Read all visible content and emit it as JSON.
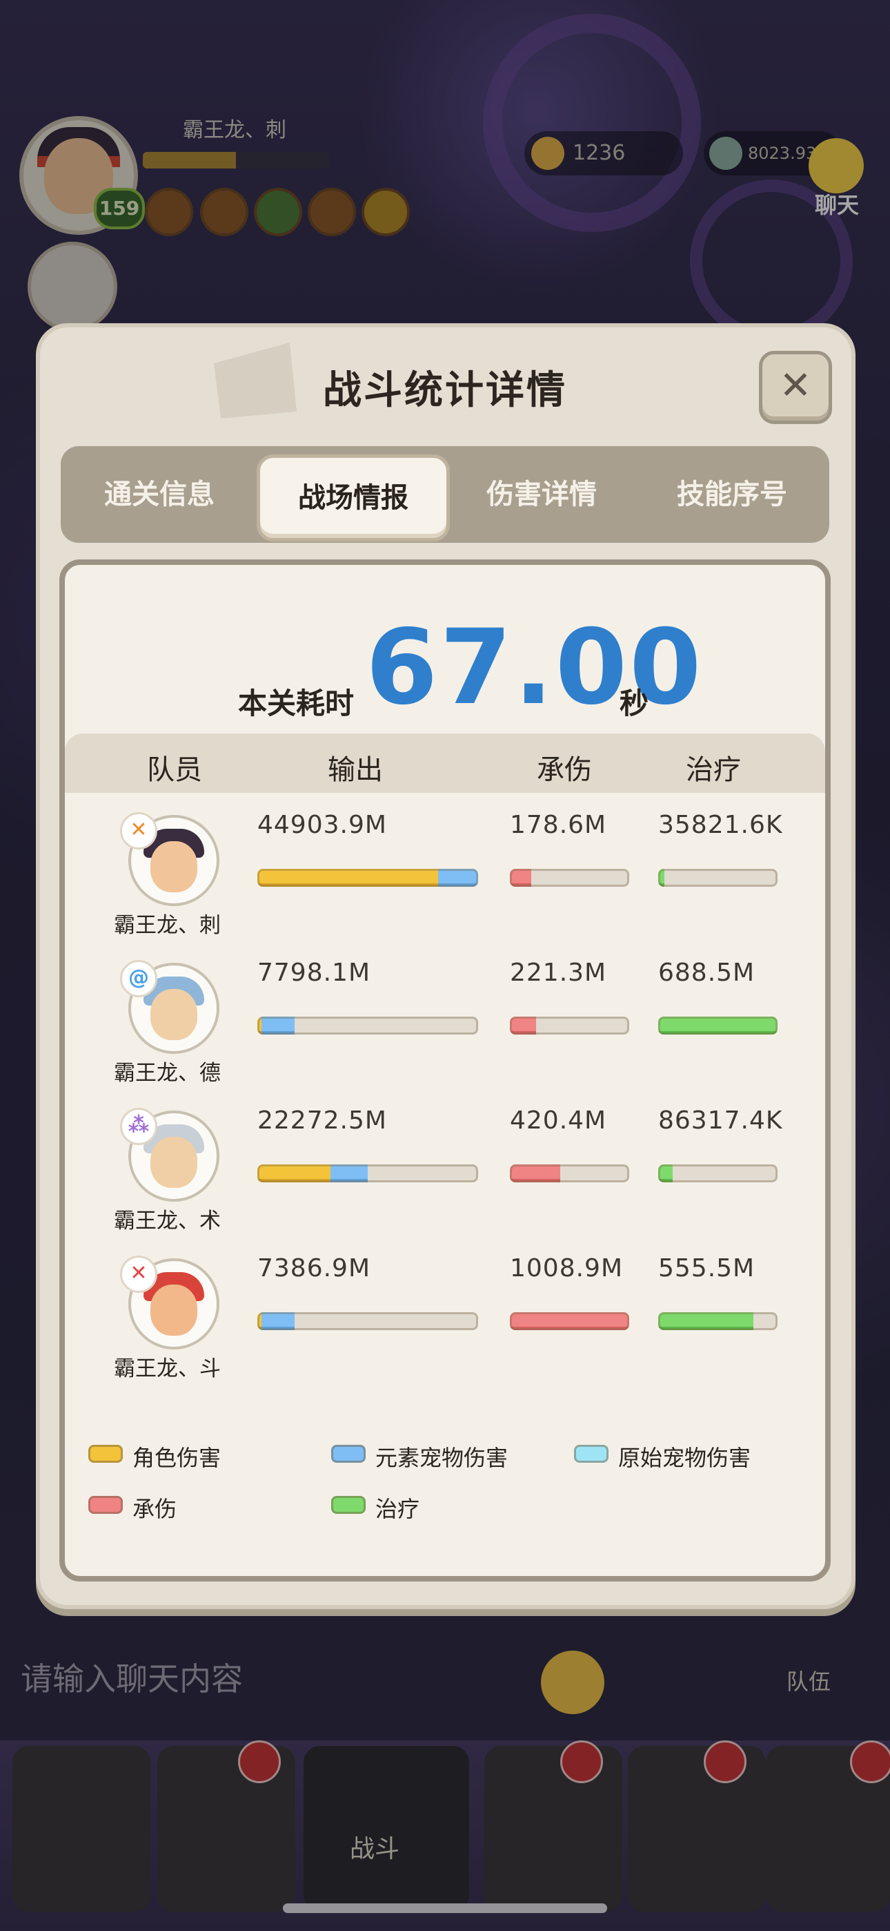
{
  "hud": {
    "player_name": "霸王龙、刺",
    "level": "159",
    "xp_fraction": 0.5,
    "currency_1": "1236",
    "currency_2": "8023.93M",
    "chat_label": "聊天"
  },
  "background": {
    "chat_placeholder": "请输入聊天内容",
    "team_label": "队伍",
    "battle_label": "战斗"
  },
  "dialog": {
    "title": "战斗统计详情",
    "close_icon": "close-icon",
    "tabs": [
      {
        "label": "通关信息",
        "active": false
      },
      {
        "label": "战场情报",
        "active": true
      },
      {
        "label": "伤害详情",
        "active": false
      },
      {
        "label": "技能序号",
        "active": false
      }
    ],
    "time_label": "本关耗时",
    "time_value": "67.00",
    "time_unit": "秒",
    "columns": {
      "member": "队员",
      "output": "输出",
      "taken": "承伤",
      "heal": "治疗"
    },
    "members": [
      {
        "name": "霸王龙、刺",
        "role_icon": "dagger-icon",
        "role_color": "#f08a2a",
        "output": "44903.9M",
        "output_char_fraction": 0.82,
        "output_elem_fraction": 0.18,
        "taken": "178.6M",
        "taken_fraction": 0.18,
        "heal": "35821.6K",
        "heal_fraction": 0.05
      },
      {
        "name": "霸王龙、德",
        "role_icon": "swirl-icon",
        "role_color": "#4aa0e8",
        "output": "7798.1M",
        "output_char_fraction": 0.02,
        "output_elem_fraction": 0.15,
        "taken": "221.3M",
        "taken_fraction": 0.22,
        "heal": "688.5M",
        "heal_fraction": 1.0
      },
      {
        "name": "霸王龙、术",
        "role_icon": "arcane-icon",
        "role_color": "#a070d6",
        "output": "22272.5M",
        "output_char_fraction": 0.33,
        "output_elem_fraction": 0.17,
        "taken": "420.4M",
        "taken_fraction": 0.42,
        "heal": "86317.4K",
        "heal_fraction": 0.12
      },
      {
        "name": "霸王龙、斗",
        "role_icon": "fist-icon",
        "role_color": "#e04848",
        "output": "7386.9M",
        "output_char_fraction": 0.02,
        "output_elem_fraction": 0.15,
        "taken": "1008.9M",
        "taken_fraction": 1.0,
        "heal": "555.5M",
        "heal_fraction": 0.8
      }
    ],
    "legend": [
      {
        "label": "角色伤害",
        "color": "#f3c43a"
      },
      {
        "label": "元素宠物伤害",
        "color": "#7fbef4"
      },
      {
        "label": "原始宠物伤害",
        "color": "#9fe4f4"
      },
      {
        "label": "承伤",
        "color": "#f08383"
      },
      {
        "label": "治疗",
        "color": "#7fda6c"
      }
    ]
  }
}
